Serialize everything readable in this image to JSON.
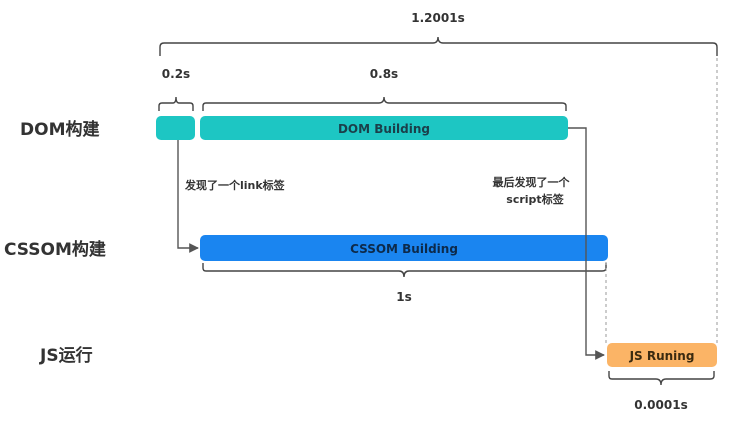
{
  "rows": {
    "dom": "DOM构建",
    "cssom": "CSSOM构建",
    "js": "JS运行"
  },
  "bars": {
    "dom_building": "DOM Building",
    "cssom_building": "CSSOM Building",
    "js_running": "JS Runing"
  },
  "durations": {
    "total": "1.2001s",
    "link_found": "0.2s",
    "dom_rest": "0.8s",
    "cssom": "1s",
    "js": "0.0001s"
  },
  "annotations": {
    "link_tag": "发现了一个link标签",
    "script_tag_line1": "最后发现了一个",
    "script_tag_line2": "script标签"
  },
  "colors": {
    "dom": "#1dc6c3",
    "cssom": "#1a85f0",
    "js": "#fbb466",
    "text": "#333333"
  }
}
